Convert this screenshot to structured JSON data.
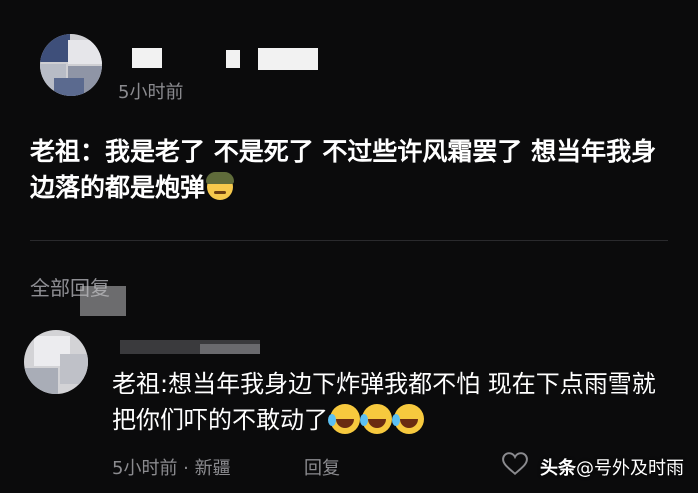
{
  "top_comment": {
    "time": "5小时前",
    "text": "老祖：我是老了 不是死了 不过些许风霜罢了 想当年我身边落的都是炮弹",
    "emoji": "helmet-face"
  },
  "replies_header": "全部回复",
  "reply": {
    "text": "老祖:想当年我身边下炸弹我都不怕 现在下点雨雪就把你们吓的不敢动了",
    "emojis": [
      "laughing-tears",
      "laughing-tears",
      "laughing-tears"
    ],
    "time": "5小时前",
    "location": "新疆",
    "meta_separator": " · ",
    "reply_label": "回复"
  },
  "watermark": {
    "brand": "头条",
    "handle": "@号外及时雨"
  }
}
